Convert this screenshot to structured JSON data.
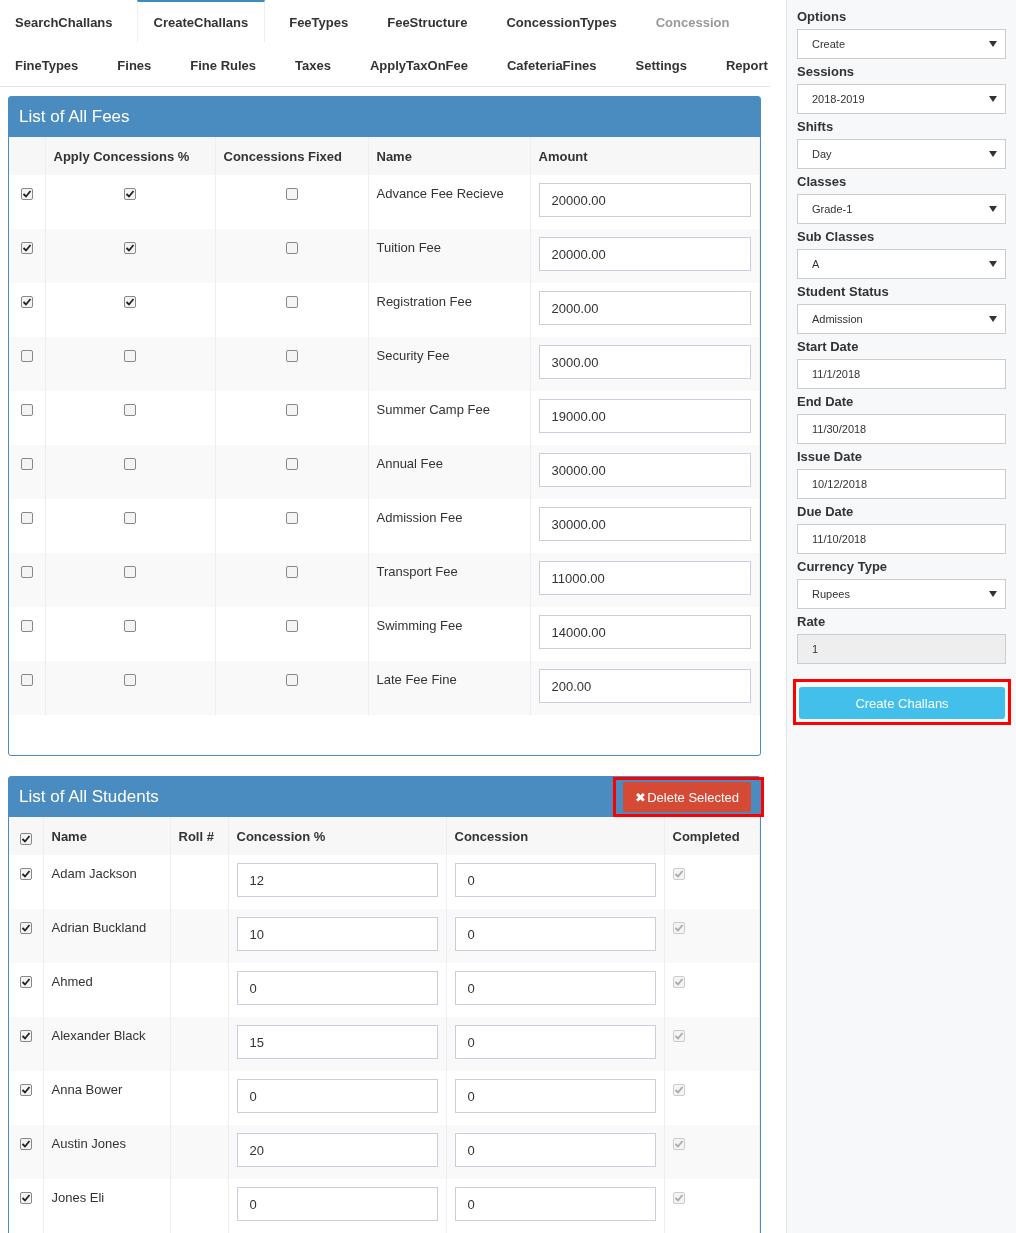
{
  "tabs": [
    [
      {
        "label": "SearchChallans",
        "selected": false,
        "disabled": false
      },
      {
        "label": "CreateChallans",
        "selected": true,
        "disabled": false
      },
      {
        "label": "FeeTypes",
        "selected": false,
        "disabled": false
      },
      {
        "label": "FeeStructure",
        "selected": false,
        "disabled": false
      },
      {
        "label": "ConcessionTypes",
        "selected": false,
        "disabled": false
      },
      {
        "label": "Concession",
        "selected": false,
        "disabled": true
      }
    ],
    [
      {
        "label": "FineTypes",
        "selected": false,
        "disabled": false
      },
      {
        "label": "Fines",
        "selected": false,
        "disabled": false
      },
      {
        "label": "Fine Rules",
        "selected": false,
        "disabled": false
      },
      {
        "label": "Taxes",
        "selected": false,
        "disabled": false
      },
      {
        "label": "ApplyTaxOnFee",
        "selected": false,
        "disabled": false
      },
      {
        "label": "CafeteriaFines",
        "selected": false,
        "disabled": false
      },
      {
        "label": "Settings",
        "selected": false,
        "disabled": false
      },
      {
        "label": "Report",
        "selected": false,
        "disabled": false
      }
    ]
  ],
  "fees": {
    "title": "List of All Fees",
    "columns": [
      "Apply Concessions %",
      "Concessions Fixed",
      "Name",
      "Amount"
    ],
    "rows": [
      {
        "checked": true,
        "apply_concession": true,
        "fixed": false,
        "name": "Advance Fee Recieve",
        "amount": "20000.00"
      },
      {
        "checked": true,
        "apply_concession": true,
        "fixed": false,
        "name": "Tuition Fee",
        "amount": "20000.00"
      },
      {
        "checked": true,
        "apply_concession": true,
        "fixed": false,
        "name": "Registration Fee",
        "amount": "2000.00"
      },
      {
        "checked": false,
        "apply_concession": false,
        "fixed": false,
        "name": "Security Fee",
        "amount": "3000.00"
      },
      {
        "checked": false,
        "apply_concession": false,
        "fixed": false,
        "name": "Summer Camp Fee",
        "amount": "19000.00"
      },
      {
        "checked": false,
        "apply_concession": false,
        "fixed": false,
        "name": "Annual Fee",
        "amount": "30000.00"
      },
      {
        "checked": false,
        "apply_concession": false,
        "fixed": false,
        "name": "Admission Fee",
        "amount": "30000.00"
      },
      {
        "checked": false,
        "apply_concession": false,
        "fixed": false,
        "name": "Transport Fee",
        "amount": "11000.00"
      },
      {
        "checked": false,
        "apply_concession": false,
        "fixed": false,
        "name": "Swimming Fee",
        "amount": "14000.00"
      },
      {
        "checked": false,
        "apply_concession": false,
        "fixed": false,
        "name": "Late Fee Fine",
        "amount": "200.00"
      }
    ]
  },
  "students": {
    "title": "List of All Students",
    "delete_button": {
      "icon": "✖",
      "label": "Delete Selected",
      "highlighted": true
    },
    "all_checked": true,
    "columns": [
      "Name",
      "Roll #",
      "Concession %",
      "Concession",
      "Completed"
    ],
    "rows": [
      {
        "checked": true,
        "name": "Adam Jackson",
        "concession_percent": "12",
        "concession": "0",
        "completed": true
      },
      {
        "checked": true,
        "name": "Adrian Buckland",
        "concession_percent": "10",
        "concession": "0",
        "completed": true
      },
      {
        "checked": true,
        "name": "Ahmed",
        "concession_percent": "0",
        "concession": "0",
        "completed": true
      },
      {
        "checked": true,
        "name": "Alexander Black",
        "concession_percent": "15",
        "concession": "0",
        "completed": true
      },
      {
        "checked": true,
        "name": "Anna Bower",
        "concession_percent": "0",
        "concession": "0",
        "completed": true
      },
      {
        "checked": true,
        "name": "Austin Jones",
        "concession_percent": "20",
        "concession": "0",
        "completed": true
      },
      {
        "checked": true,
        "name": "Jones Eli",
        "concession_percent": "0",
        "concession": "0",
        "completed": true
      }
    ]
  },
  "sidebar": {
    "fields": [
      {
        "label": "Options",
        "kind": "select",
        "value": "Create",
        "disabled": false
      },
      {
        "label": "Sessions",
        "kind": "select",
        "value": "2018-2019",
        "disabled": false
      },
      {
        "label": "Shifts",
        "kind": "select",
        "value": "Day",
        "disabled": false
      },
      {
        "label": "Classes",
        "kind": "select",
        "value": "Grade-1",
        "disabled": false
      },
      {
        "label": "Sub Classes",
        "kind": "select",
        "value": "A",
        "disabled": false
      },
      {
        "label": "Student Status",
        "kind": "select",
        "value": "Admission",
        "disabled": false
      },
      {
        "label": "Start Date",
        "kind": "text",
        "value": "11/1/2018",
        "disabled": false
      },
      {
        "label": "End Date",
        "kind": "text",
        "value": "11/30/2018",
        "disabled": false
      },
      {
        "label": "Issue Date",
        "kind": "text",
        "value": "10/12/2018",
        "disabled": false
      },
      {
        "label": "Due Date",
        "kind": "text",
        "value": "11/10/2018",
        "disabled": false
      },
      {
        "label": "Currency Type",
        "kind": "select",
        "value": "Rupees",
        "disabled": false
      },
      {
        "label": "Rate",
        "kind": "text",
        "value": "1",
        "disabled": true
      }
    ],
    "create_button": {
      "label": "Create Challans",
      "highlighted": true
    }
  }
}
